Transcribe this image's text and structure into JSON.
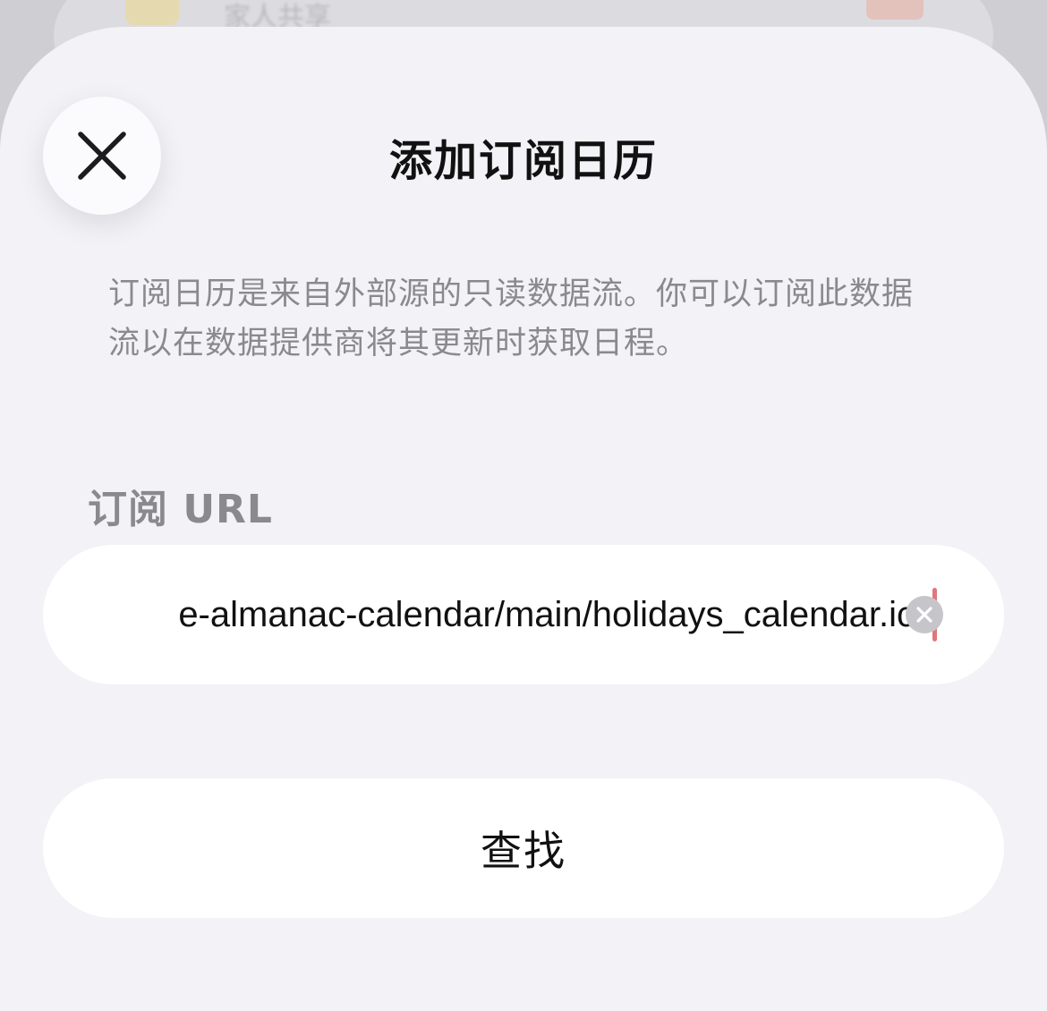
{
  "background": {
    "peek_text": "家人共享"
  },
  "sheet": {
    "title": "添加订阅日历",
    "close_icon": "close-x-icon",
    "description": "订阅日历是来自外部源的只读数据流。你可以订阅此数据流以在数据提供商将其更新时获取日程。",
    "url_label": "订阅 URL",
    "url_value": "e-almanac-calendar/main/holidays_calendar.ics",
    "clear_icon": "clear-circle-icon",
    "search_button_label": "查找"
  },
  "colors": {
    "sheet_background": "#f2f2f7",
    "secondary_text": "#8a8a8e",
    "caret": "#e0767c"
  }
}
